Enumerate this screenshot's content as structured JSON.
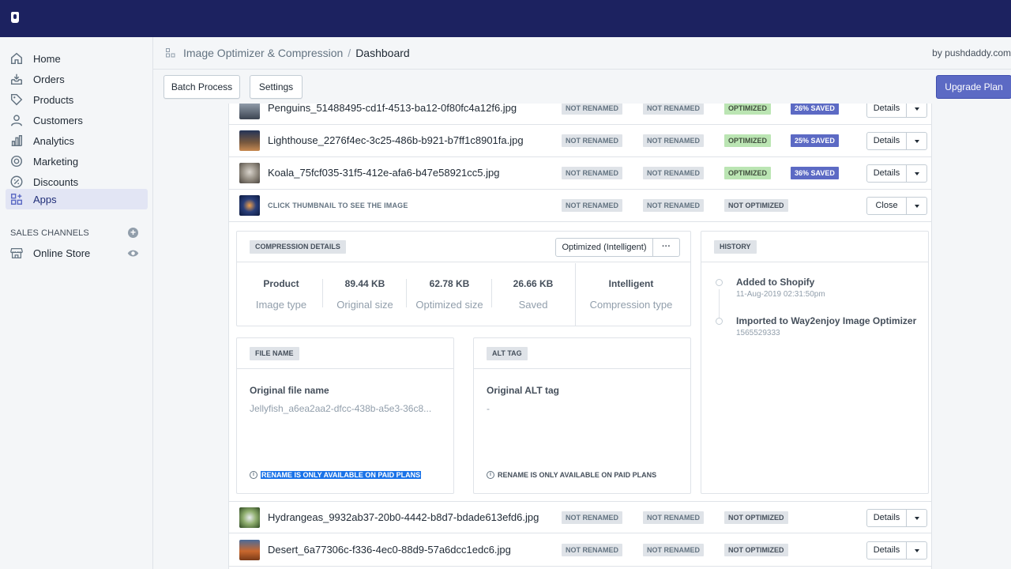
{
  "app": {
    "breadcrumb_app": "Image Optimizer & Compression",
    "breadcrumb_sep": "/",
    "breadcrumb_page": "Dashboard",
    "byline": "by pushdaddy.com"
  },
  "sidebar": {
    "items": [
      {
        "label": "Home",
        "icon": "home-icon"
      },
      {
        "label": "Orders",
        "icon": "orders-icon"
      },
      {
        "label": "Products",
        "icon": "tag-icon"
      },
      {
        "label": "Customers",
        "icon": "person-icon"
      },
      {
        "label": "Analytics",
        "icon": "bar-chart-icon"
      },
      {
        "label": "Marketing",
        "icon": "target-icon"
      },
      {
        "label": "Discounts",
        "icon": "discount-icon"
      },
      {
        "label": "Apps",
        "icon": "apps-icon"
      }
    ],
    "section_label": "SALES CHANNELS",
    "channels": [
      {
        "label": "Online Store",
        "icon": "store-icon"
      }
    ]
  },
  "toolbar": {
    "batch_label": "Batch Process",
    "settings_label": "Settings",
    "upgrade_label": "Upgrade Plan"
  },
  "rows": [
    {
      "name": "Penguins_51488495-cd1f-4513-ba12-0f80fc4a12f6.jpg",
      "b1": "NOT RENAMED",
      "b2": "NOT RENAMED",
      "status": "OPTIMIZED",
      "saved": "26% SAVED",
      "action": "Details"
    },
    {
      "name": "Lighthouse_2276f4ec-3c25-486b-b921-b7ff1c8901fa.jpg",
      "b1": "NOT RENAMED",
      "b2": "NOT RENAMED",
      "status": "OPTIMIZED",
      "saved": "25% SAVED",
      "action": "Details"
    },
    {
      "name": "Koala_75fcf035-31f5-412e-afa6-b47e58921cc5.jpg",
      "b1": "NOT RENAMED",
      "b2": "NOT RENAMED",
      "status": "OPTIMIZED",
      "saved": "36% SAVED",
      "action": "Details"
    },
    {
      "name": "CLICK THUMBNAIL TO SEE THE IMAGE",
      "b1": "NOT RENAMED",
      "b2": "NOT RENAMED",
      "status": "NOT OPTIMIZED",
      "saved": "",
      "action": "Close"
    },
    {
      "name": "Hydrangeas_9932ab37-20b0-4442-b8d7-bdade613efd6.jpg",
      "b1": "NOT RENAMED",
      "b2": "NOT RENAMED",
      "status": "NOT OPTIMIZED",
      "saved": "",
      "action": "Details"
    },
    {
      "name": "Desert_6a77306c-f336-4ec0-88d9-57a6dcc1edc6.jpg",
      "b1": "NOT RENAMED",
      "b2": "NOT RENAMED",
      "status": "NOT OPTIMIZED",
      "saved": "",
      "action": "Details"
    }
  ],
  "compression": {
    "tag": "COMPRESSION DETAILS",
    "mode": "Optimized (Intelligent)",
    "more": "···",
    "stats": [
      {
        "value": "Product",
        "key": "Image type"
      },
      {
        "value": "89.44 KB",
        "key": "Original size"
      },
      {
        "value": "62.78 KB",
        "key": "Optimized size"
      },
      {
        "value": "26.66 KB",
        "key": "Saved"
      },
      {
        "value": "Intelligent",
        "key": "Compression type"
      }
    ]
  },
  "history": {
    "tag": "HISTORY",
    "items": [
      {
        "title": "Added to Shopify",
        "date": "11-Aug-2019 02:31:50pm"
      },
      {
        "title": "Imported to Way2enjoy Image Optimizer",
        "date": "1565529333"
      }
    ]
  },
  "file_name": {
    "tag": "FILE NAME",
    "label": "Original file name",
    "value": "Jellyfish_a6ea2aa2-dfcc-438b-a5e3-36c8...",
    "note": "RENAME IS ONLY AVAILABLE ON PAID PLANS"
  },
  "alt_tag": {
    "tag": "ALT TAG",
    "label": "Original ALT tag",
    "value": "-",
    "note": "RENAME IS ONLY AVAILABLE ON PAID PLANS"
  },
  "colors": {
    "topbar": "#1c2260",
    "accent": "#5c6ac4",
    "optimized": "#bbe5b3"
  }
}
